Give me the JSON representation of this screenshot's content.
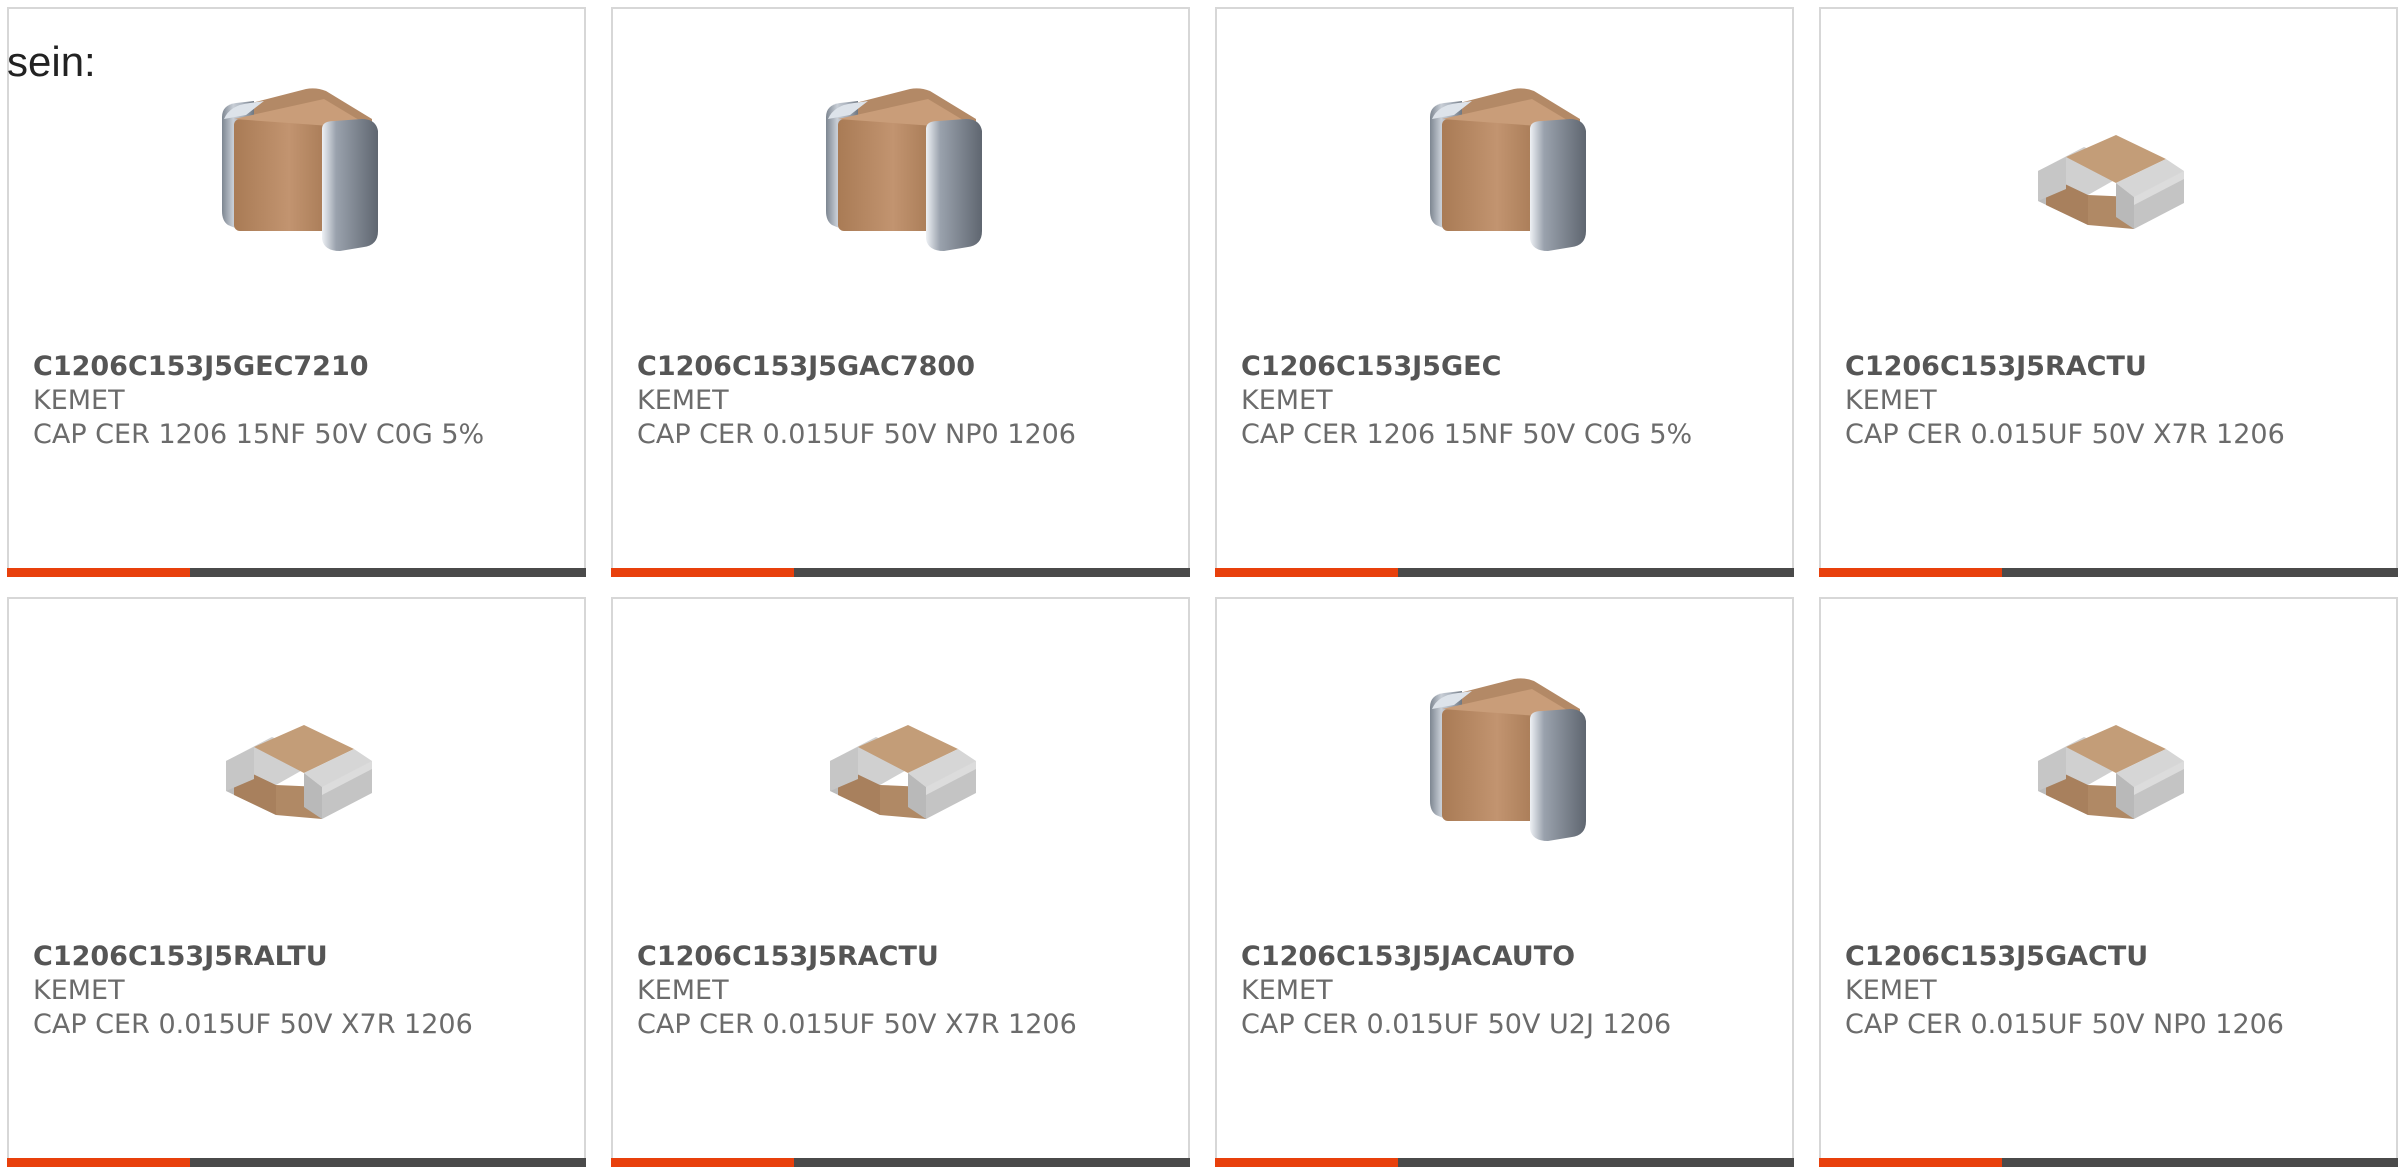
{
  "intro_text": "sein:",
  "colors": {
    "accent": "#e8400c",
    "bar": "#4a4a4a",
    "title": "#555555",
    "text": "#6b6b6b",
    "border": "#d7d7d7"
  },
  "products": [
    {
      "part_number": "C1206C153J5GEC7210",
      "manufacturer": "KEMET",
      "description": "CAP CER 1206 15NF 50V C0G 5%",
      "image": "capacitor-terminated-icon"
    },
    {
      "part_number": "C1206C153J5GAC7800",
      "manufacturer": "KEMET",
      "description": "CAP CER 0.015UF 50V NP0 1206",
      "image": "capacitor-terminated-icon"
    },
    {
      "part_number": "C1206C153J5GEC",
      "manufacturer": "KEMET",
      "description": "CAP CER 1206 15NF 50V C0G 5%",
      "image": "capacitor-terminated-icon"
    },
    {
      "part_number": "C1206C153J5RACTU",
      "manufacturer": "KEMET",
      "description": "CAP CER 0.015UF 50V X7R 1206",
      "image": "capacitor-chip-icon"
    },
    {
      "part_number": "C1206C153J5RALTU",
      "manufacturer": "KEMET",
      "description": "CAP CER 0.015UF 50V X7R 1206",
      "image": "capacitor-chip-icon"
    },
    {
      "part_number": "C1206C153J5RACTU",
      "manufacturer": "KEMET",
      "description": "CAP CER 0.015UF 50V X7R 1206",
      "image": "capacitor-chip-icon"
    },
    {
      "part_number": "C1206C153J5JACAUTO",
      "manufacturer": "KEMET",
      "description": "CAP CER 0.015UF 50V U2J 1206",
      "image": "capacitor-terminated-icon"
    },
    {
      "part_number": "C1206C153J5GACTU",
      "manufacturer": "KEMET",
      "description": "CAP CER 0.015UF 50V NP0 1206",
      "image": "capacitor-chip-icon"
    }
  ]
}
